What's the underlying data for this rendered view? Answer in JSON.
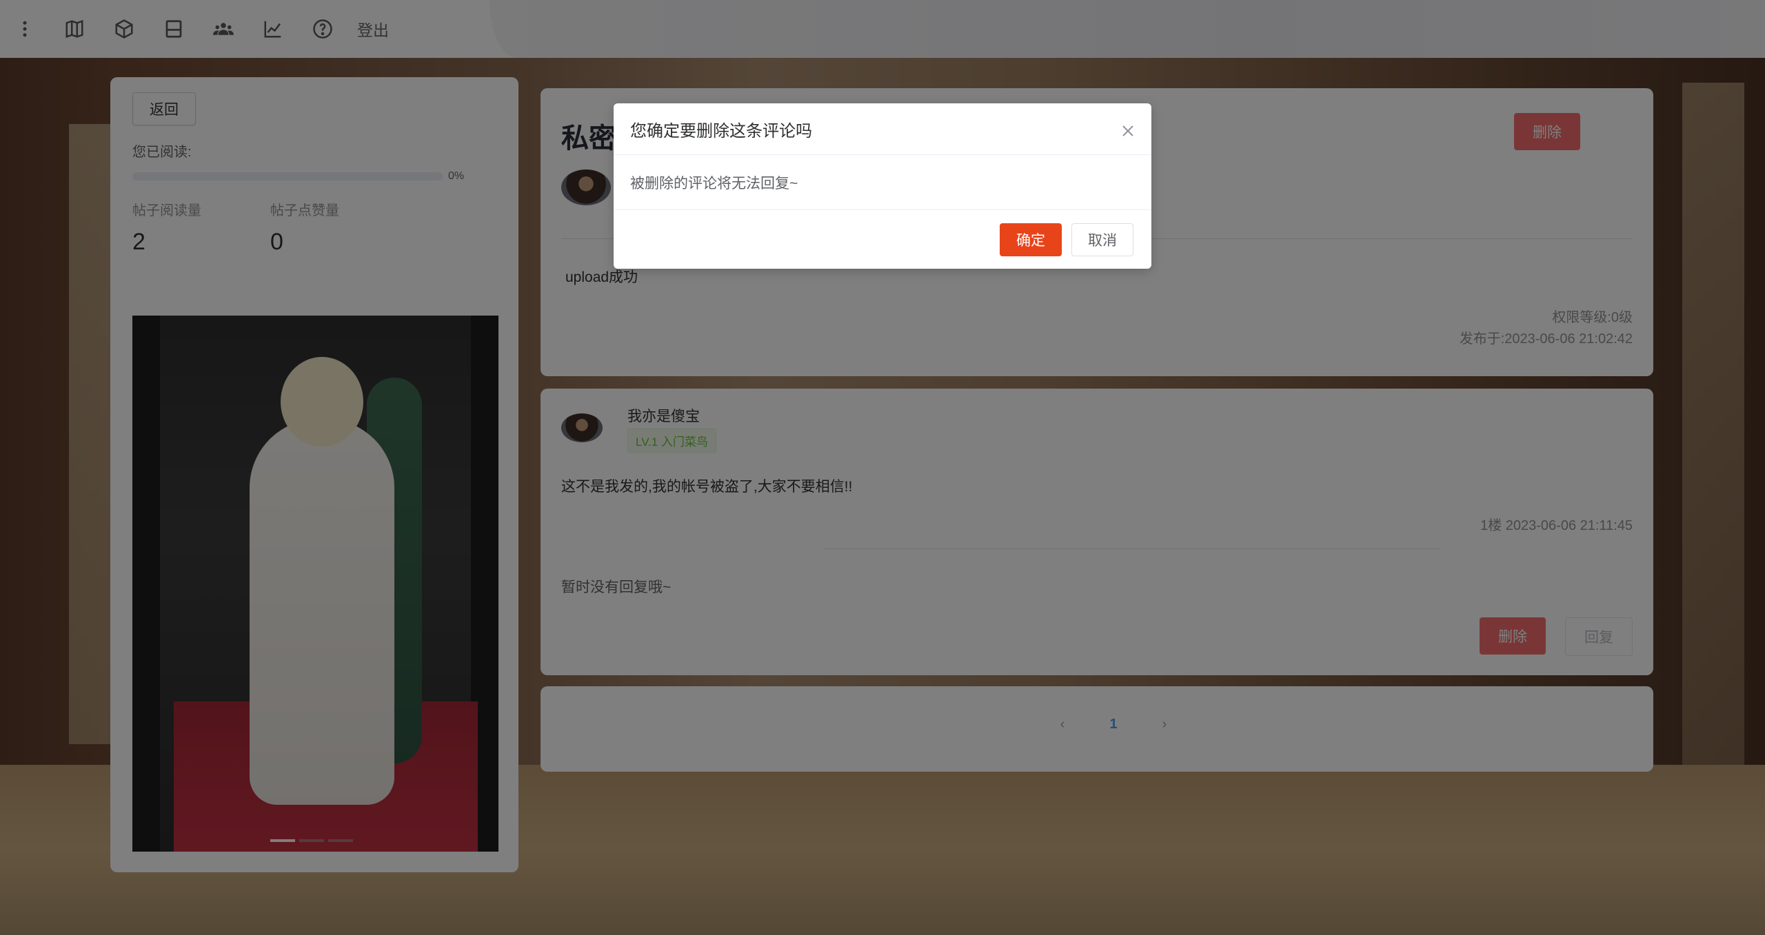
{
  "topbar": {
    "icons": [
      "more-vertical-icon",
      "map-icon",
      "cube-icon",
      "layout-icon",
      "users-icon",
      "chart-line-icon",
      "help-icon"
    ],
    "logout_label": "登出"
  },
  "left_panel": {
    "back_label": "返回",
    "read_label": "您已阅读:",
    "progress_percent": 0,
    "progress_text": "0%",
    "views_title": "帖子阅读量",
    "views_value": "2",
    "likes_title": "帖子点赞量",
    "likes_value": "0"
  },
  "post": {
    "title": "私密",
    "body": "upload成功",
    "permission": "权限等级:0级",
    "published": "发布于:2023-06-06 21:02:42",
    "delete_label": "删除"
  },
  "comment": {
    "author": "我亦是傻宝",
    "level": "LV.1 入门菜鸟",
    "body": "这不是我发的,我的帐号被盗了,大家不要相信!!",
    "meta": "1楼 2023-06-06 21:11:45",
    "no_reply": "暂时没有回复哦~",
    "delete_label": "删除",
    "reply_label": "回复"
  },
  "pager": {
    "prev": "‹",
    "current": "1",
    "next": "›"
  },
  "dialog": {
    "title": "您确定要删除这条评论吗",
    "message": "被删除的评论将无法回复~",
    "confirm_label": "确定",
    "cancel_label": "取消"
  }
}
